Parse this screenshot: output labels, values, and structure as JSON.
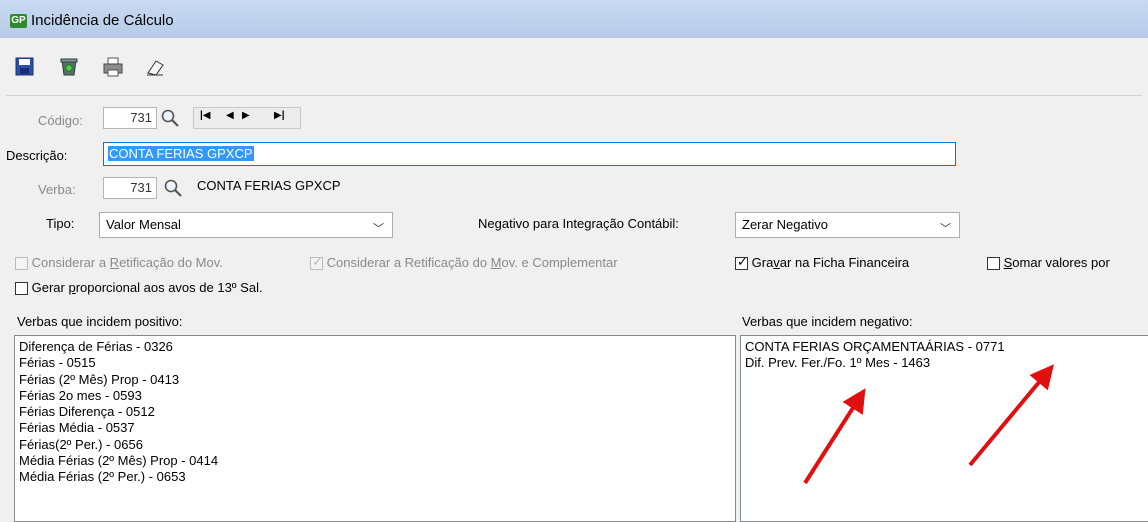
{
  "window": {
    "logo_text": "GP",
    "title": "Incidência de Cálculo"
  },
  "toolbar": {
    "icons": [
      "save-icon",
      "delete-icon",
      "print-icon",
      "clear-icon"
    ]
  },
  "form": {
    "codigo_label": "Código:",
    "codigo_value": "731",
    "descricao_label": "Descrição:",
    "descricao_value": "CONTA FERIAS GPXCP",
    "verba_label": "Verba:",
    "verba_value": "731",
    "verba_desc": "CONTA FERIAS GPXCP",
    "tipo_label": "Tipo:",
    "tipo_value": "Valor Mensal",
    "negativo_label": "Negativo para Integração Contábil:",
    "negativo_value": "Zerar Negativo"
  },
  "checks": {
    "retificacao": {
      "pre": "Considerar a ",
      "u": "R",
      "post": "etificação do Mov.",
      "checked": false,
      "disabled": true
    },
    "retificacao_compl": {
      "pre": "Considerar a Retificação do ",
      "u": "M",
      "post": "ov. e Complementar",
      "checked": true,
      "disabled": true
    },
    "gravar": {
      "pre": "Gra",
      "u": "v",
      "post": "ar na Ficha Financeira",
      "checked": true,
      "disabled": false
    },
    "somar": {
      "pre": "",
      "u": "S",
      "post": "omar valores por",
      "checked": false,
      "disabled": false
    },
    "gerar": {
      "pre": "Gerar ",
      "u": "p",
      "post": "roporcional aos avos de 13º Sal.",
      "checked": false,
      "disabled": false
    }
  },
  "positivo": {
    "label": "Verbas que incidem positivo:",
    "items": [
      "Diferença de Férias - 0326",
      "Férias - 0515",
      "Férias (2º Mês) Prop - 0413",
      "Férias 2o mes - 0593",
      "Férias Diferença - 0512",
      "Férias Média - 0537",
      "Férias(2º Per.) - 0656",
      "Média Férias (2º Mês) Prop - 0414",
      "Média Férias (2º Per.) - 0653"
    ]
  },
  "negativo_list": {
    "label": "Verbas que incidem negativo:",
    "items": [
      "CONTA FERIAS ORÇAMENTAÁRIAS - 0771",
      "Dif. Prev. Fer./Fo. 1º Mes - 1463"
    ]
  },
  "colors": {
    "arrow": "#e01010",
    "selection": "#3399ff",
    "focus_border": "#0078d7"
  }
}
